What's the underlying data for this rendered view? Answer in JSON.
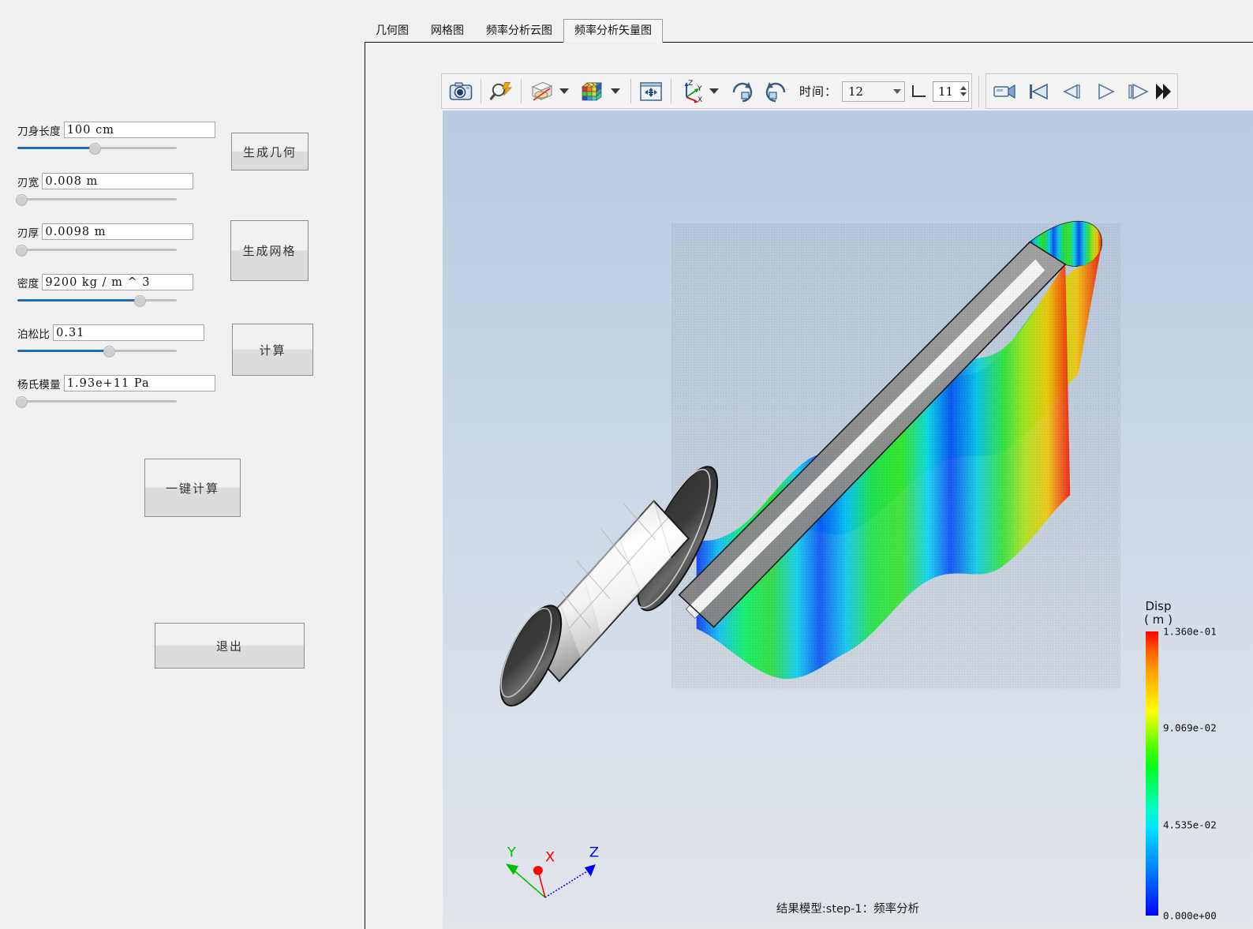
{
  "left_panel": {
    "params": [
      {
        "label": "刀身长度",
        "value": "100 cm",
        "slider_pct": 48,
        "filled": true
      },
      {
        "label": "刃宽",
        "value": "0.008 m",
        "slider_pct": 2,
        "filled": false
      },
      {
        "label": "刃厚",
        "value": "0.0098 m",
        "slider_pct": 2,
        "filled": false
      },
      {
        "label": "密度",
        "value": "9200 kg / m ^ 3",
        "slider_pct": 76,
        "filled": true
      },
      {
        "label": "泊松比",
        "value": "0.31",
        "slider_pct": 57,
        "filled": true
      },
      {
        "label": "杨氏模量",
        "value": "1.93e+11 Pa",
        "slider_pct": 2,
        "filled": false
      }
    ],
    "buttons": {
      "generate_geometry": "生成几何",
      "generate_mesh": "生成网格",
      "compute": "计算",
      "one_click": "一键计算",
      "exit": "退出"
    }
  },
  "tabs": [
    {
      "label": "几何图",
      "active": false
    },
    {
      "label": "网格图",
      "active": false
    },
    {
      "label": "频率分析云图",
      "active": false
    },
    {
      "label": "频率分析矢量图",
      "active": true
    }
  ],
  "toolbar": {
    "icons": {
      "snapshot": "camera-icon",
      "zoom_fit": "magnifier-lightning-icon",
      "clip_plane": "box-section-icon",
      "color_cube": "color-cube-icon",
      "pan": "pan-arrows-icon",
      "axis_triad": "axis-triad-icon",
      "rotate_cw": "rotate-cw-icon",
      "rotate_ccw": "rotate-ccw-icon",
      "record": "video-camera-icon",
      "first_frame": "skip-to-start-icon",
      "step_back": "step-back-icon",
      "play": "play-icon",
      "step_forward": "step-forward-icon",
      "expand": "expand-arrows-icon"
    },
    "time_label": "时间：",
    "time_value": "12",
    "frame_value": "11"
  },
  "viewport": {
    "status": "结果模型:step-1：频率分析",
    "axis_triad": {
      "x": "X",
      "y": "Y",
      "z": "Z",
      "x_color": "#ff0000",
      "y_color": "#00c000",
      "z_color": "#0000ff"
    },
    "legend": {
      "title": "Disp",
      "units": "( m )",
      "ticks": [
        "1.360e-01",
        "9.069e-02",
        "4.535e-02",
        "0.000e+00"
      ],
      "tick_pcts": [
        0,
        34,
        68,
        100
      ],
      "max": "1.360e-01",
      "min": "0.000e+00"
    },
    "colors": {
      "bg_top": "#b8cce4",
      "bg_bottom": "#e2e5ea",
      "blade_gray": "#9a9a9a",
      "handle_dark": "#3a3a3a",
      "accent_blue": "#1f6bb5"
    }
  }
}
